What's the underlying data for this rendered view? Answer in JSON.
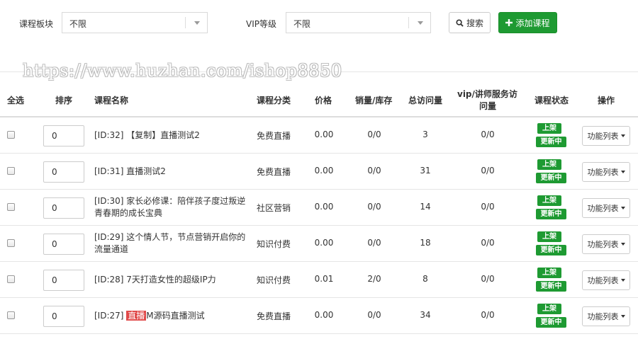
{
  "filters": {
    "category_label": "课程板块",
    "category_value": "不限",
    "vip_label": "VIP等级",
    "vip_value": "不限",
    "search_label": "搜索",
    "add_label": "添加课程"
  },
  "watermark": "https://www.huzhan.com/ishop8850",
  "table": {
    "headers": {
      "select_all": "全选",
      "sort": "排序",
      "name": "课程名称",
      "category": "课程分类",
      "price": "价格",
      "sales_stock": "销量/库存",
      "visits": "总访问量",
      "vip_line1": "vip/讲师服务访",
      "vip_line2": "问量",
      "status": "课程状态",
      "ops": "操作"
    },
    "rows": [
      {
        "sort": "0",
        "name": "[ID:32] 【复制】直播测试2",
        "category": "免费直播",
        "price": "0.00",
        "sales_stock": "0/0",
        "visits": "3",
        "vip_visits": "0/0",
        "status_on": "上架",
        "status_upd": "更新中",
        "fn": "功能列表"
      },
      {
        "sort": "0",
        "name": "[ID:31] 直播测试2",
        "category": "免费直播",
        "price": "0.00",
        "sales_stock": "0/0",
        "visits": "31",
        "vip_visits": "0/0",
        "status_on": "上架",
        "status_upd": "更新中",
        "fn": "功能列表"
      },
      {
        "sort": "0",
        "name_l1": "[ID:30] 家长必修课：陪伴孩子度过叛逆",
        "name_l2": "青春期的成长宝典",
        "category": "社区营销",
        "price": "0.00",
        "sales_stock": "0/0",
        "visits": "14",
        "vip_visits": "0/0",
        "status_on": "上架",
        "status_upd": "更新中",
        "fn": "功能列表"
      },
      {
        "sort": "0",
        "name_l1": "[ID:29] 这个情人节，节点营销开启你的",
        "name_l2": "流量通道",
        "category": "知识付费",
        "price": "0.00",
        "sales_stock": "0/0",
        "visits": "18",
        "vip_visits": "0/0",
        "status_on": "上架",
        "status_upd": "更新中",
        "fn": "功能列表"
      },
      {
        "sort": "0",
        "name": "[ID:28] 7天打造女性的超级IP力",
        "category": "知识付费",
        "price": "0.01",
        "sales_stock": "2/0",
        "visits": "8",
        "vip_visits": "0/0",
        "status_on": "上架",
        "status_upd": "更新中",
        "fn": "功能列表"
      },
      {
        "sort": "0",
        "name_prefix": "[ID:27] ",
        "name_badge": "直播",
        "name_suffix": "M源码直播测试",
        "category": "免费直播",
        "price": "0.00",
        "sales_stock": "0/0",
        "visits": "34",
        "vip_visits": "0/0",
        "status_on": "上架",
        "status_upd": "更新中",
        "fn": "功能列表"
      }
    ]
  },
  "icons": {
    "search": "search-icon",
    "add": "plus-icon",
    "dropdown": "caret-down-icon"
  }
}
